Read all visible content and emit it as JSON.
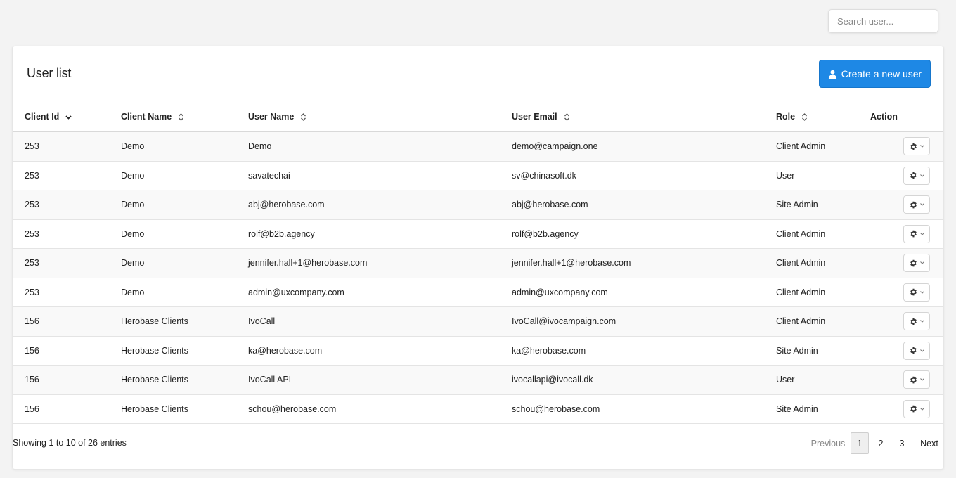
{
  "search": {
    "placeholder": "Search user..."
  },
  "page": {
    "title": "User list"
  },
  "create_button": {
    "label": "Create a new user"
  },
  "table": {
    "headers": {
      "client_id": "Client Id",
      "client_name": "Client Name",
      "user_name": "User Name",
      "user_email": "User Email",
      "role": "Role",
      "action": "Action"
    },
    "sort": {
      "column": "client_id",
      "direction": "desc"
    },
    "rows": [
      {
        "client_id": "253",
        "client_name": "Demo",
        "user_name": "Demo",
        "user_email": "demo@campaign.one",
        "role": "Client Admin"
      },
      {
        "client_id": "253",
        "client_name": "Demo",
        "user_name": "savatechai",
        "user_email": "sv@chinasoft.dk",
        "role": "User"
      },
      {
        "client_id": "253",
        "client_name": "Demo",
        "user_name": "abj@herobase.com",
        "user_email": "abj@herobase.com",
        "role": "Site Admin"
      },
      {
        "client_id": "253",
        "client_name": "Demo",
        "user_name": "rolf@b2b.agency",
        "user_email": "rolf@b2b.agency",
        "role": "Client Admin"
      },
      {
        "client_id": "253",
        "client_name": "Demo",
        "user_name": "jennifer.hall+1@herobase.com",
        "user_email": "jennifer.hall+1@herobase.com",
        "role": "Client Admin"
      },
      {
        "client_id": "253",
        "client_name": "Demo",
        "user_name": "admin@uxcompany.com",
        "user_email": "admin@uxcompany.com",
        "role": "Client Admin"
      },
      {
        "client_id": "156",
        "client_name": "Herobase Clients",
        "user_name": "IvoCall",
        "user_email": "IvoCall@ivocampaign.com",
        "role": "Client Admin"
      },
      {
        "client_id": "156",
        "client_name": "Herobase Clients",
        "user_name": "ka@herobase.com",
        "user_email": "ka@herobase.com",
        "role": "Site Admin"
      },
      {
        "client_id": "156",
        "client_name": "Herobase Clients",
        "user_name": "IvoCall API",
        "user_email": "ivocallapi@ivocall.dk",
        "role": "User"
      },
      {
        "client_id": "156",
        "client_name": "Herobase Clients",
        "user_name": "schou@herobase.com",
        "user_email": "schou@herobase.com",
        "role": "Site Admin"
      }
    ]
  },
  "footer": {
    "info": "Showing 1 to 10 of 26 entries",
    "pagination": {
      "previous": "Previous",
      "pages": [
        "1",
        "2",
        "3"
      ],
      "current": "1",
      "next": "Next"
    }
  },
  "colors": {
    "accent": "#1e88e5",
    "background": "#f3f3f3"
  },
  "icons": {
    "create": "user-icon",
    "action": "gear-icon",
    "dropdown": "chevron-down-icon"
  }
}
